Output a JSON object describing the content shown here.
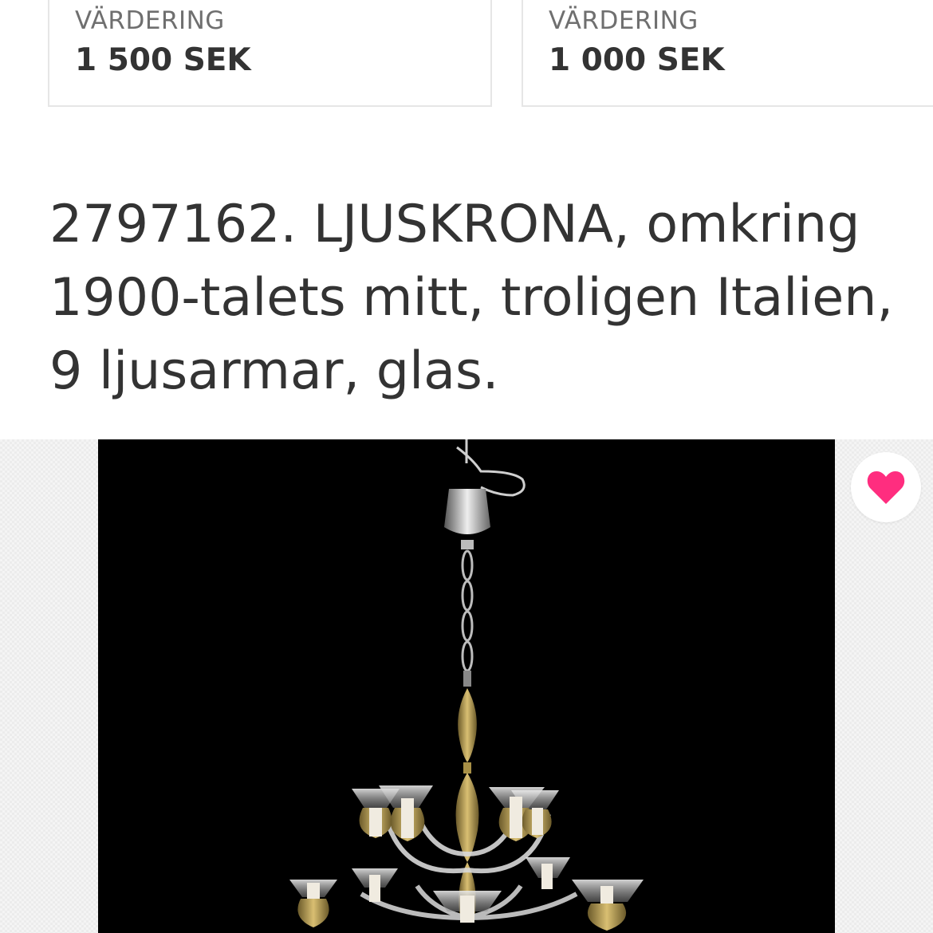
{
  "valuations": [
    {
      "label": "VÄRDERING",
      "value": "1 500 SEK"
    },
    {
      "label": "VÄRDERING",
      "value": "1 000 SEK"
    }
  ],
  "lot": {
    "title": "2797162. LJUSKRONA, omkring 1900-talets mitt, troligen Italien, 9 ljusarmar, glas."
  },
  "image": {
    "subject": "chandelier-photo"
  },
  "favorite": {
    "icon": "heart-icon",
    "color": "#ff2d7f",
    "active": true
  }
}
